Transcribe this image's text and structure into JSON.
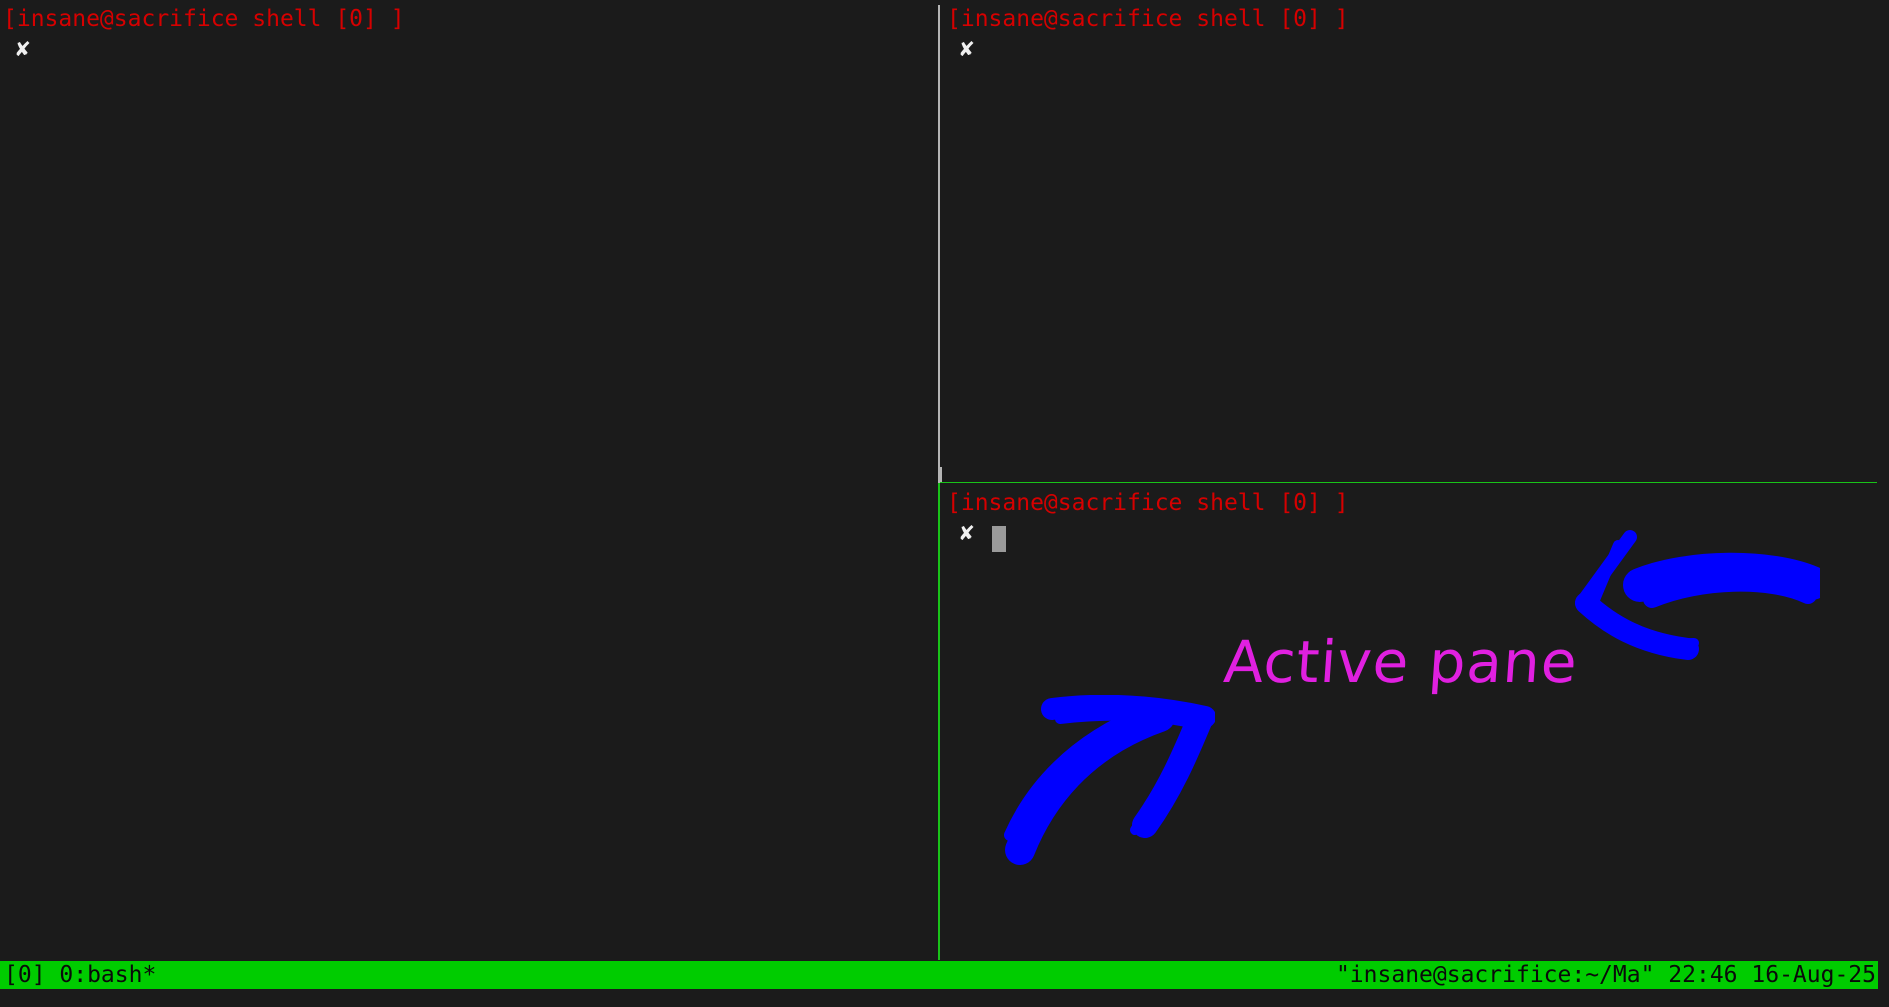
{
  "panes": {
    "left": {
      "prompt": "[insane@sacrifice shell [0] ]",
      "glyph": "✘"
    },
    "top_right": {
      "prompt": "[insane@sacrifice shell [0] ]",
      "glyph": "✘"
    },
    "bottom_right": {
      "prompt": "[insane@sacrifice shell [0] ]",
      "glyph": "✘"
    }
  },
  "status_bar": {
    "left": "[0] 0:bash*",
    "right": "\"insane@sacrifice:~/Ma\" 22:46 16-Aug-25",
    "color": "#00cc00"
  },
  "annotation": {
    "text": "Active pane",
    "text_color": "#e020e0",
    "arrow_color": "#0000ff"
  },
  "colors": {
    "background": "#1b1b1b",
    "prompt": "#d60000",
    "active_border": "#19c319",
    "inactive_border": "#b5b5b5"
  }
}
